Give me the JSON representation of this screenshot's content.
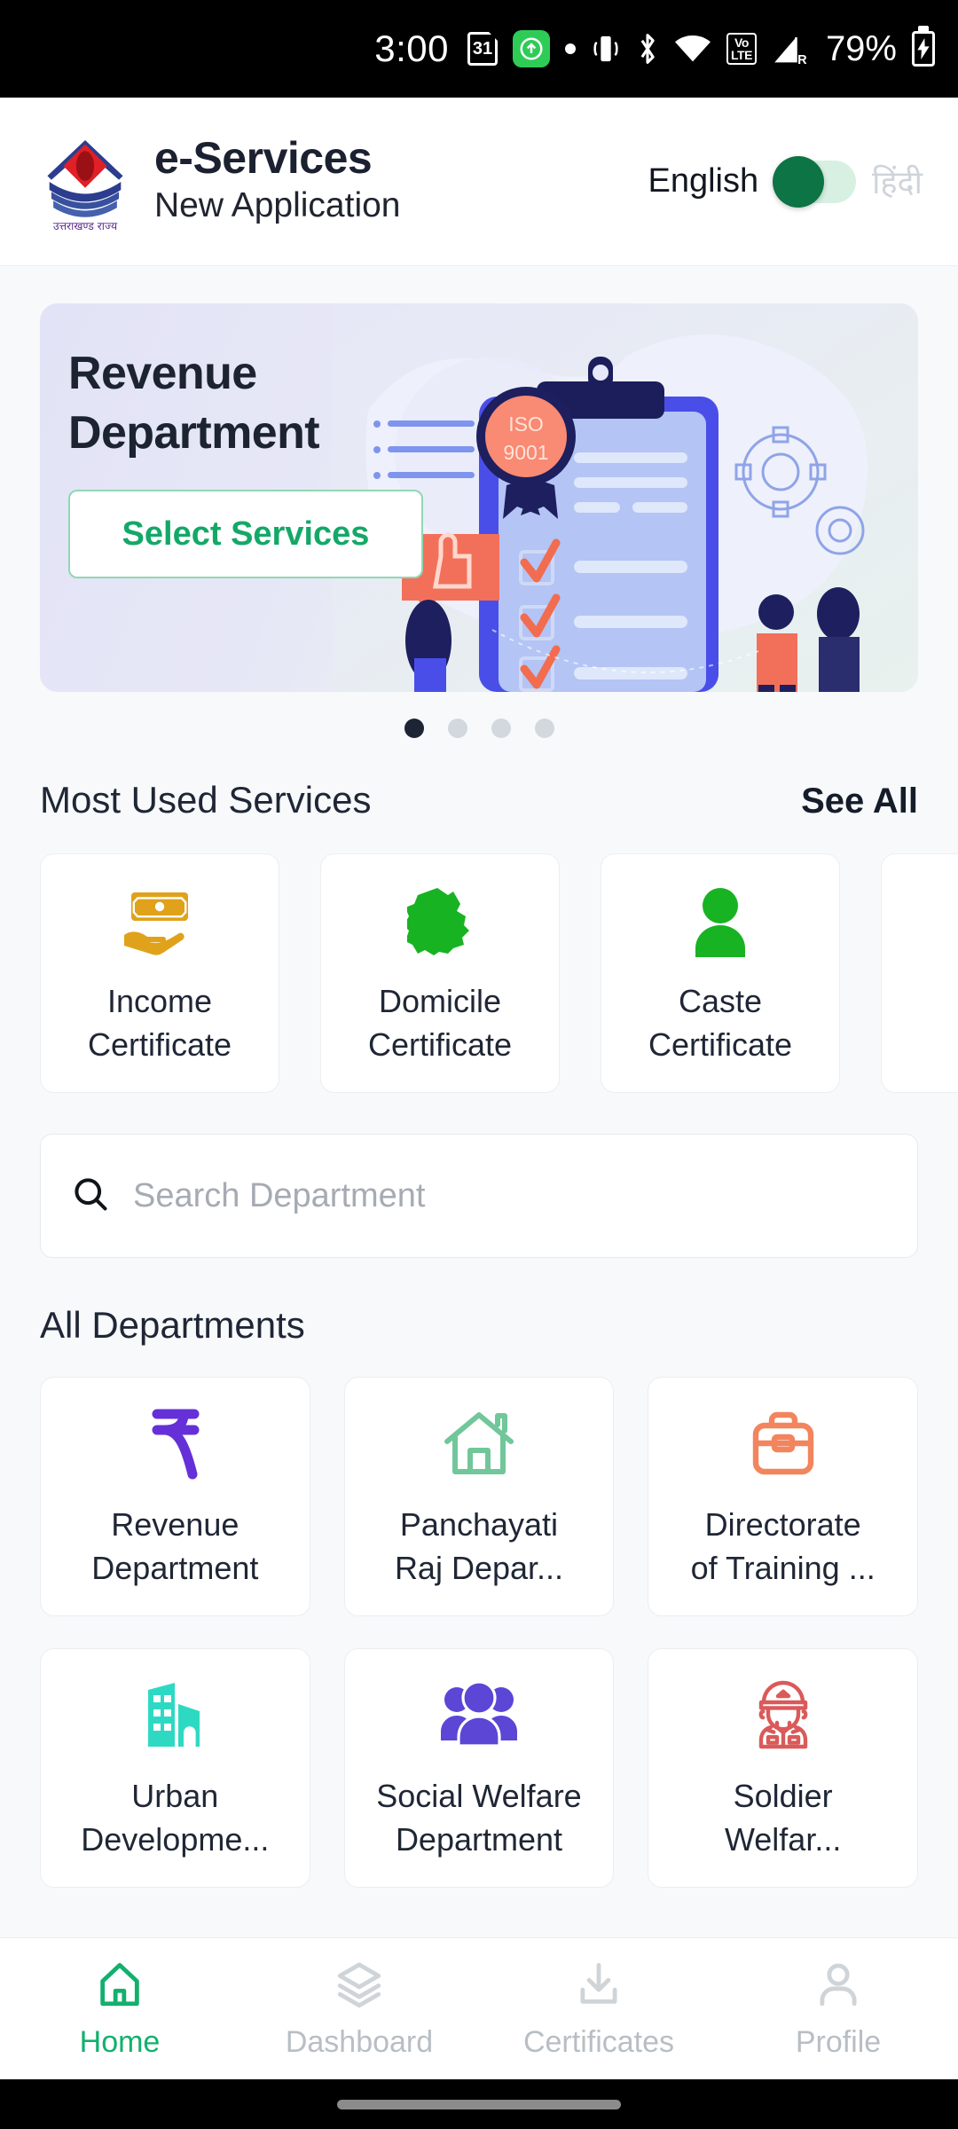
{
  "status_bar": {
    "time": "3:00",
    "calendar_day": "31",
    "battery_percent": "79%",
    "volte_label": "VoLTE",
    "signal_roaming": "R",
    "icons": [
      "calendar-icon",
      "upload-icon",
      "dot-icon",
      "vibrate-icon",
      "bluetooth-icon",
      "wifi-icon",
      "volte-icon",
      "signal-icon",
      "battery-charging-icon"
    ]
  },
  "header": {
    "logo_alt": "uttarakhand-state-emblem",
    "logo_caption": "उत्तराखण्ड राज्य",
    "title": "e-Services",
    "subtitle": "New Application",
    "language": {
      "left_label": "English",
      "right_label": "हिंदी",
      "selected": "English",
      "toggle_color": "#0c7445",
      "track_color": "#d7f0e2"
    }
  },
  "banner": {
    "title_line1": "Revenue",
    "title_line2": "Department",
    "button_label": "Select Services",
    "button_text_color": "#14a868",
    "badge_text_line1": "ISO",
    "badge_text_line2": "9001",
    "dots_total": 4,
    "dot_active_index": 0
  },
  "most_used": {
    "section_title": "Most Used Services",
    "see_all_label": "See All",
    "items": [
      {
        "label_line1": "Income",
        "label_line2": "Certificate",
        "icon": "money-in-hand-icon",
        "color": "#e0a21b"
      },
      {
        "label_line1": "Domicile",
        "label_line2": "Certificate",
        "icon": "state-map-icon",
        "color": "#18b322"
      },
      {
        "label_line1": "Caste",
        "label_line2": "Certificate",
        "icon": "person-icon",
        "color": "#18b322"
      },
      {
        "label_line1": "",
        "label_line2": "",
        "icon": "partial-card",
        "color": "#ffffff"
      }
    ]
  },
  "search": {
    "placeholder": "Search Department",
    "icon": "search-icon",
    "value": ""
  },
  "departments": {
    "section_title": "All Departments",
    "items": [
      {
        "label_line1": "Revenue",
        "label_line2": "Department",
        "icon": "rupee-icon",
        "color": "#6530d8"
      },
      {
        "label_line1": "Panchayati",
        "label_line2": "Raj Depar...",
        "icon": "house-icon",
        "color": "#71c79a"
      },
      {
        "label_line1": "Directorate",
        "label_line2": "of Training ...",
        "icon": "briefcase-icon",
        "color": "#f2855e"
      },
      {
        "label_line1": "Urban",
        "label_line2": "Developme...",
        "icon": "buildings-icon",
        "color": "#2ed9c3"
      },
      {
        "label_line1": "Social Welfare",
        "label_line2": "Department",
        "icon": "people-group-icon",
        "color": "#5b46d6"
      },
      {
        "label_line1": "Soldier",
        "label_line2": "Welfar...",
        "icon": "soldier-icon",
        "color": "#da5a5a"
      }
    ]
  },
  "bottom_nav": {
    "active_index": 0,
    "active_color": "#13b06e",
    "inactive_color": "#b8bec4",
    "items": [
      {
        "label": "Home",
        "icon": "home-icon"
      },
      {
        "label": "Dashboard",
        "icon": "layers-icon"
      },
      {
        "label": "Certificates",
        "icon": "download-icon"
      },
      {
        "label": "Profile",
        "icon": "person-outline-icon"
      }
    ]
  }
}
